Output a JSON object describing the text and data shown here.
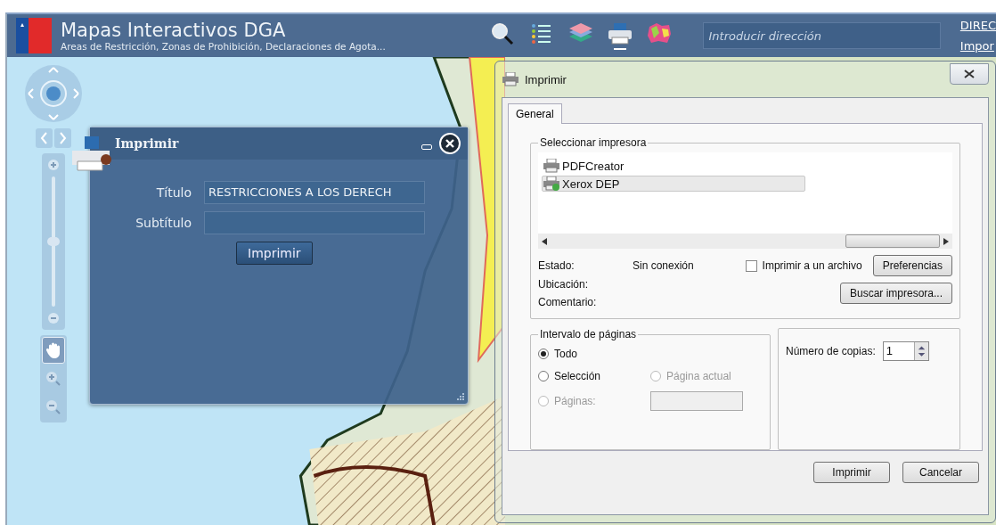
{
  "header": {
    "title": "Mapas Interactivos DGA",
    "subtitle": "Areas de Restricción, Zonas de Prohibición, Declaraciones de Agota...",
    "tools": [
      {
        "kind": "search",
        "selected": false
      },
      {
        "kind": "legend",
        "selected": false
      },
      {
        "kind": "layers",
        "selected": false
      },
      {
        "kind": "print",
        "selected": true
      },
      {
        "kind": "regions",
        "selected": false
      }
    ],
    "search": {
      "placeholder": "Introducir dirección"
    },
    "links": [
      "DIREC",
      "Impor"
    ]
  },
  "map_controls": {
    "zoom": {
      "level": 0.5
    },
    "tools": [
      {
        "kind": "pan",
        "selected": true
      },
      {
        "kind": "zoom-in",
        "selected": false
      },
      {
        "kind": "zoom-out",
        "selected": false
      }
    ]
  },
  "print_panel": {
    "title": "Imprimir",
    "fields": [
      {
        "label": "Título",
        "value": "RESTRICCIONES A LOS DERECH"
      },
      {
        "label": "Subtítulo"
      }
    ],
    "button": "Imprimir"
  },
  "print_dialog": {
    "title": "Imprimir",
    "tabs": [
      {
        "label": "General",
        "selected": true
      }
    ],
    "printer_group": {
      "label": "Seleccionar impresora",
      "printers": [
        {
          "name": "PDFCreator",
          "selected": false,
          "default": false
        },
        {
          "name": "Xerox DEP",
          "selected": true,
          "default": true
        }
      ],
      "info": [
        {
          "label": "Estado:",
          "value": "Sin conexión"
        },
        {
          "label": "Ubicación:"
        },
        {
          "label": "Comentario:"
        }
      ],
      "print_to_file": {
        "label": "Imprimir a un archivo",
        "checked": false
      },
      "buttons": [
        "Preferencias",
        "Buscar impresora..."
      ]
    },
    "range_group": {
      "label": "Intervalo de páginas",
      "options": [
        {
          "label": "Todo",
          "selected": true,
          "disabled": false
        },
        {
          "label": "Selección",
          "selected": false,
          "disabled": false
        },
        {
          "label": "Página actual",
          "selected": false,
          "disabled": true
        },
        {
          "label": "Páginas:",
          "selected": false,
          "disabled": true
        }
      ],
      "pages_field": {
        "disabled": true
      }
    },
    "copies": {
      "label": "Número de copias:",
      "value": "1"
    },
    "buttons": [
      "Imprimir",
      "Cancelar"
    ]
  }
}
